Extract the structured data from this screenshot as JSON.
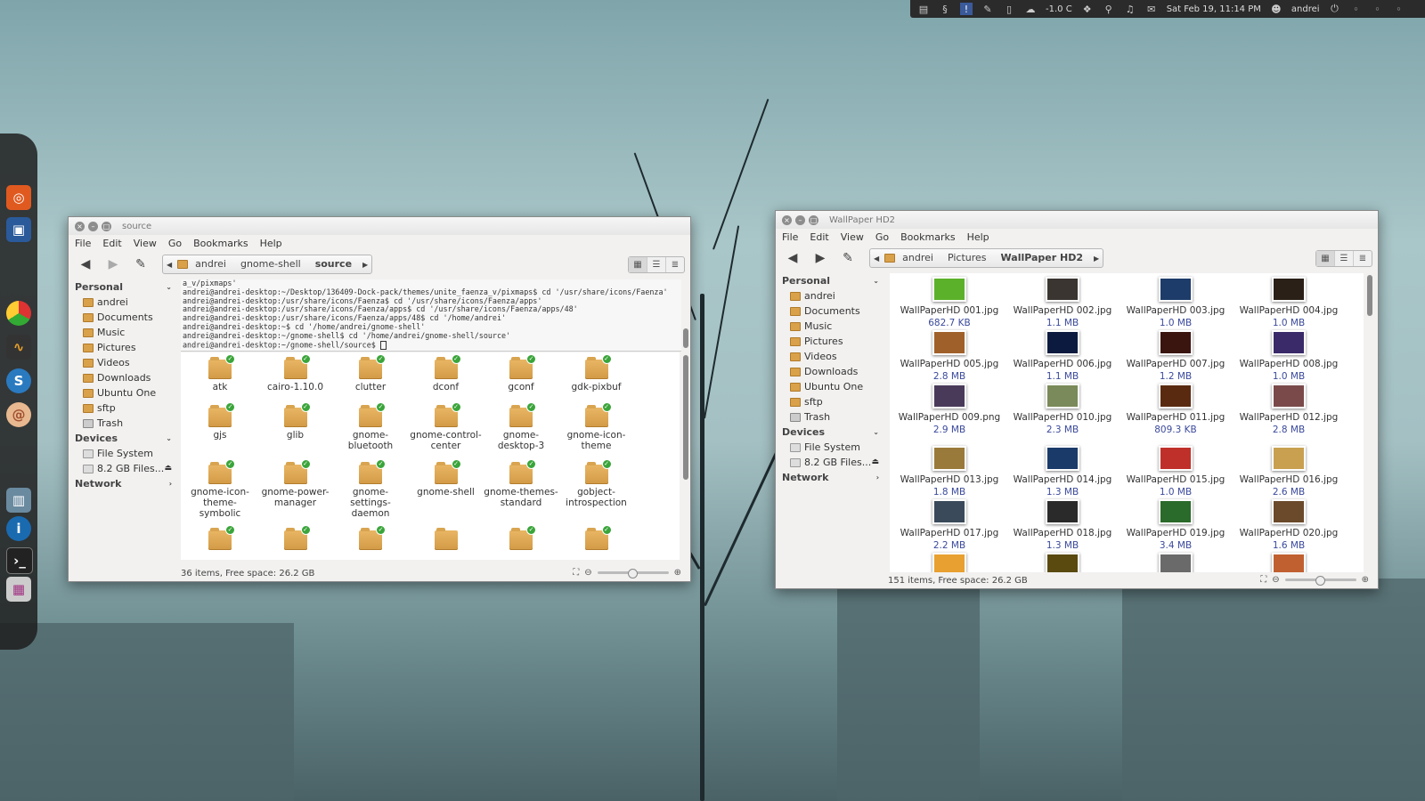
{
  "top_panel": {
    "temperature": "-1.0 C",
    "datetime": "Sat Feb 19, 11:14 PM",
    "user": "andrei"
  },
  "left_window": {
    "title": "source",
    "menu": [
      "File",
      "Edit",
      "View",
      "Go",
      "Bookmarks",
      "Help"
    ],
    "breadcrumbs": [
      "andrei",
      "gnome-shell",
      "source"
    ],
    "sidebar": {
      "personal_label": "Personal",
      "personal": [
        "andrei",
        "Documents",
        "Music",
        "Pictures",
        "Videos",
        "Downloads",
        "Ubuntu One",
        "sftp",
        "Trash"
      ],
      "devices_label": "Devices",
      "devices": [
        "File System",
        "8.2 GB Files..."
      ],
      "network_label": "Network"
    },
    "terminal_lines": [
      "a_v/pixmaps'",
      "andrei@andrei-desktop:~/Desktop/136409-Dock-pack/themes/unite_faenza_v/pixmaps$ cd '/usr/share/icons/Faenza'",
      "andrei@andrei-desktop:/usr/share/icons/Faenza$ cd '/usr/share/icons/Faenza/apps'",
      "andrei@andrei-desktop:/usr/share/icons/Faenza/apps$ cd '/usr/share/icons/Faenza/apps/48'",
      "andrei@andrei-desktop:/usr/share/icons/Faenza/apps/48$ cd '/home/andrei'",
      "andrei@andrei-desktop:~$ cd '/home/andrei/gnome-shell'",
      "andrei@andrei-desktop:~/gnome-shell$ cd '/home/andrei/gnome-shell/source'",
      "andrei@andrei-desktop:~/gnome-shell/source$ "
    ],
    "folders": [
      [
        "atk"
      ],
      [
        "cairo-1.10.0"
      ],
      [
        "clutter"
      ],
      [
        "dconf"
      ],
      [
        "gconf"
      ],
      [
        "gdk-pixbuf"
      ],
      [
        "gjs"
      ],
      [
        "glib"
      ],
      [
        "gnome-",
        "bluetooth"
      ],
      [
        "gnome-control-",
        "center"
      ],
      [
        "gnome-",
        "desktop-3"
      ],
      [
        "gnome-icon-",
        "theme"
      ],
      [
        "gnome-icon-",
        "theme-symbolic"
      ],
      [
        "gnome-power-",
        "manager"
      ],
      [
        "gnome-",
        "settings-",
        "daemon"
      ],
      [
        "gnome-shell"
      ],
      [
        "gnome-themes-",
        "standard"
      ],
      [
        "gobject-",
        "introspection"
      ],
      [
        ""
      ],
      [
        ""
      ],
      [
        ""
      ],
      [
        ""
      ],
      [
        ""
      ],
      [
        ""
      ]
    ],
    "status": "36 items, Free space: 26.2 GB"
  },
  "right_window": {
    "title": "WallPaper HD2",
    "menu": [
      "File",
      "Edit",
      "View",
      "Go",
      "Bookmarks",
      "Help"
    ],
    "breadcrumbs": [
      "andrei",
      "Pictures",
      "WallPaper HD2"
    ],
    "sidebar": {
      "personal_label": "Personal",
      "personal": [
        "andrei",
        "Documents",
        "Music",
        "Pictures",
        "Videos",
        "Downloads",
        "Ubuntu One",
        "sftp",
        "Trash"
      ],
      "devices_label": "Devices",
      "devices": [
        "File System",
        "8.2 GB Files..."
      ],
      "network_label": "Network"
    },
    "files": [
      {
        "name": "WallPaperHD 001.jpg",
        "size": "682.7 KB",
        "color": "#5cb12a"
      },
      {
        "name": "WallPaperHD 002.jpg",
        "size": "1.1 MB",
        "color": "#3a3530"
      },
      {
        "name": "WallPaperHD 003.jpg",
        "size": "1.0 MB",
        "color": "#1d3c6a"
      },
      {
        "name": "WallPaperHD 004.jpg",
        "size": "1.0 MB",
        "color": "#2a2018"
      },
      {
        "name": "WallPaperHD 005.jpg",
        "size": "2.8 MB",
        "color": "#a0602a"
      },
      {
        "name": "WallPaperHD 006.jpg",
        "size": "1.1 MB",
        "color": "#0d1a40"
      },
      {
        "name": "WallPaperHD 007.jpg",
        "size": "1.2 MB",
        "color": "#3a1510"
      },
      {
        "name": "WallPaperHD 008.jpg",
        "size": "1.0 MB",
        "color": "#3a2a6a"
      },
      {
        "name": "WallPaperHD 009.png",
        "size": "2.9 MB",
        "color": "#4a3a5a"
      },
      {
        "name": "WallPaperHD 010.jpg",
        "size": "2.3 MB",
        "color": "#7a8a5a"
      },
      {
        "name": "WallPaperHD 011.jpg",
        "size": "809.3 KB",
        "color": "#5a2a10"
      },
      {
        "name": "WallPaperHD 012.jpg",
        "size": "2.8 MB",
        "color": "#7a4a4a"
      },
      {
        "name": "WallPaperHD 013.jpg",
        "size": "1.8 MB",
        "color": "#9a7a3a"
      },
      {
        "name": "WallPaperHD 014.jpg",
        "size": "1.3 MB",
        "color": "#1a3a6a"
      },
      {
        "name": "WallPaperHD 015.jpg",
        "size": "1.0 MB",
        "color": "#c0302a"
      },
      {
        "name": "WallPaperHD 016.jpg",
        "size": "2.6 MB",
        "color": "#c8a050"
      },
      {
        "name": "WallPaperHD 017.jpg",
        "size": "2.2 MB",
        "color": "#3a4a5a"
      },
      {
        "name": "WallPaperHD 018.jpg",
        "size": "1.3 MB",
        "color": "#2a2a2a"
      },
      {
        "name": "WallPaperHD 019.jpg",
        "size": "3.4 MB",
        "color": "#2a6a2a"
      },
      {
        "name": "WallPaperHD 020.jpg",
        "size": "1.6 MB",
        "color": "#6a4a2a"
      },
      {
        "name": "",
        "size": "",
        "color": "#e8a030"
      },
      {
        "name": "",
        "size": "",
        "color": "#5a4a10"
      },
      {
        "name": "",
        "size": "",
        "color": "#6a6a6a"
      },
      {
        "name": "",
        "size": "",
        "color": "#c06030"
      }
    ],
    "status": "151 items, Free space: 26.2 GB"
  }
}
